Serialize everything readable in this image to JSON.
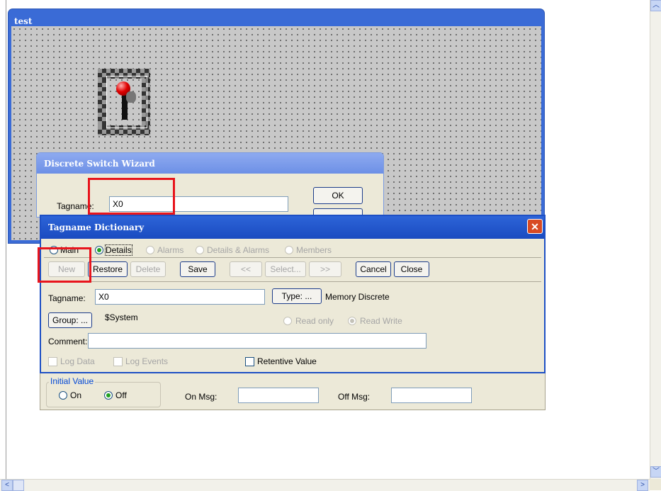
{
  "test_window": {
    "title": "test"
  },
  "wizard": {
    "title": "Discrete Switch Wizard",
    "tagname_label": "Tagname:",
    "tagname_value": "X0",
    "ok_label": "OK"
  },
  "dictionary": {
    "title": "Tagname Dictionary",
    "close_glyph": "✕",
    "modes": [
      {
        "label": "Main",
        "selected": false,
        "enabled": true
      },
      {
        "label": "Details",
        "selected": true,
        "enabled": true
      },
      {
        "label": "Alarms",
        "selected": false,
        "enabled": false
      },
      {
        "label": "Details & Alarms",
        "selected": false,
        "enabled": false
      },
      {
        "label": "Members",
        "selected": false,
        "enabled": false
      }
    ],
    "buttons": {
      "new": "New",
      "restore": "Restore",
      "delete": "Delete",
      "save": "Save",
      "prev": "<<",
      "select": "Select...",
      "next": ">>",
      "cancel": "Cancel",
      "close": "Close"
    },
    "tagname_label": "Tagname:",
    "tagname_value": "X0",
    "type_button": "Type: ...",
    "type_value": "Memory Discrete",
    "group_button": "Group: ...",
    "group_value": "$System",
    "read_only_label": "Read only",
    "read_write_label": "Read Write",
    "comment_label": "Comment:",
    "comment_value": "",
    "log_data_label": "Log Data",
    "log_events_label": "Log Events",
    "retentive_label": "Retentive Value"
  },
  "initial_value": {
    "title": "Initial Value",
    "on_label": "On",
    "off_label": "Off",
    "selected": "Off",
    "on_msg_label": "On Msg:",
    "on_msg_value": "",
    "off_msg_label": "Off Msg:",
    "off_msg_value": ""
  },
  "scrollbars": {
    "up": "︿",
    "down": "﹀",
    "left": "<",
    "right": ">"
  },
  "colors": {
    "title_bar": "#1a4bc0",
    "highlight": "#e8141c",
    "dialog_bg": "#ece9d8"
  }
}
